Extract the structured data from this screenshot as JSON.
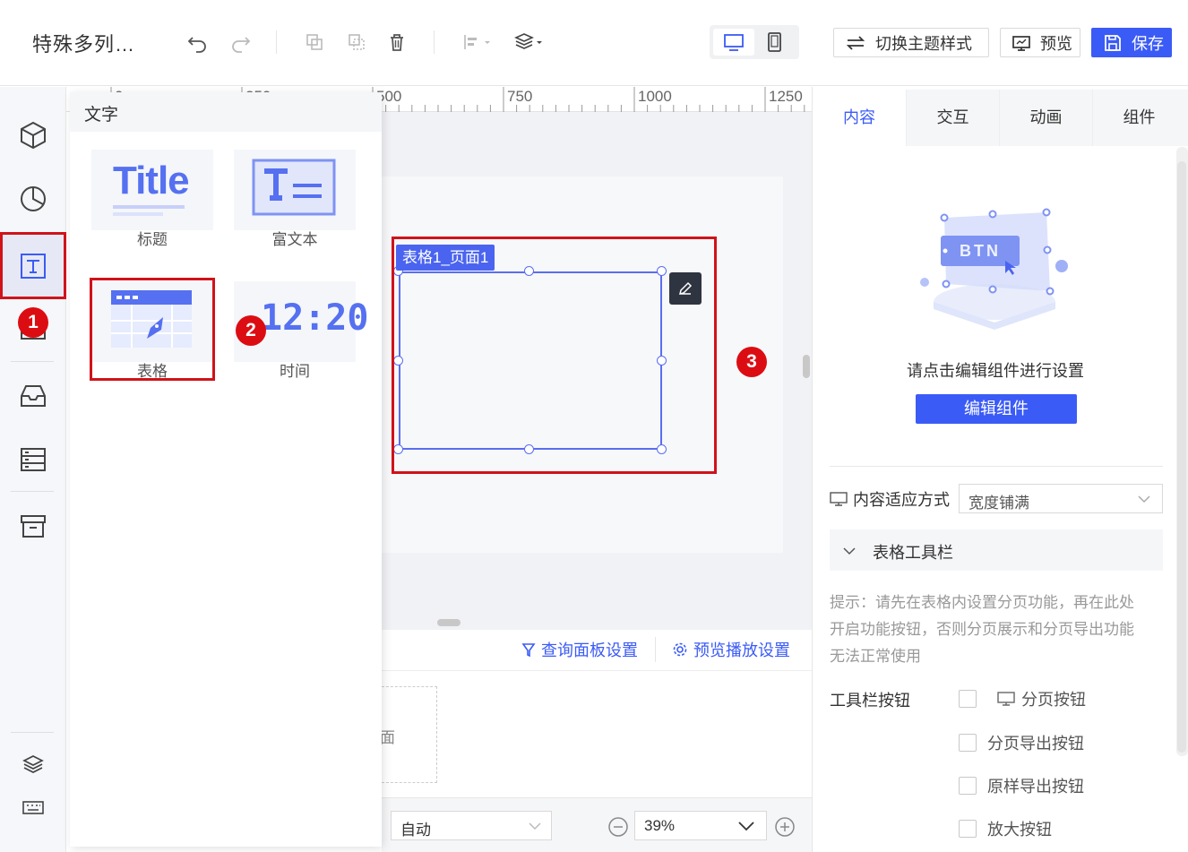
{
  "header": {
    "title": "特殊多列…",
    "theme_btn": "切换主题样式",
    "preview_btn": "预览",
    "save_btn": "保存"
  },
  "ruler": {
    "ticks": [
      "0",
      "250",
      "500",
      "750",
      "1000",
      "1250"
    ]
  },
  "flyout": {
    "title": "文字",
    "items": [
      {
        "label": "标题",
        "thumb_text": "Title"
      },
      {
        "label": "富文本"
      },
      {
        "label": "表格"
      },
      {
        "label": "时间",
        "thumb_text": "12:20"
      }
    ]
  },
  "badges": [
    "1",
    "2",
    "3"
  ],
  "canvas": {
    "component_tag": "表格1_页面1"
  },
  "bottom": {
    "query_panel": "查询面板设置",
    "preview_play": "预览播放设置",
    "page_thumb_fragment": "面",
    "auto_select": "自动",
    "zoom": "39%"
  },
  "right_panel": {
    "tabs": [
      "内容",
      "交互",
      "动画",
      "组件"
    ],
    "active_tab": "内容",
    "illustration_text": "BTN",
    "hint": "请点击编辑组件进行设置",
    "edit_btn": "编辑组件",
    "fit_label": "内容适应方式",
    "fit_value": "宽度铺满",
    "section": "表格工具栏",
    "tip_lines": [
      "提示：请先在表格内设置分页功能，再在此处",
      "开启功能按钮，否则分页展示和分页导出功能",
      "无法正常使用"
    ],
    "toolbar_label": "工具栏按钮",
    "options": [
      "分页按钮",
      "分页导出按钮",
      "原样导出按钮",
      "放大按钮"
    ]
  },
  "colors": {
    "accent": "#3b5bf6",
    "highlight": "#d0121b",
    "selection": "#5a6ef0"
  }
}
